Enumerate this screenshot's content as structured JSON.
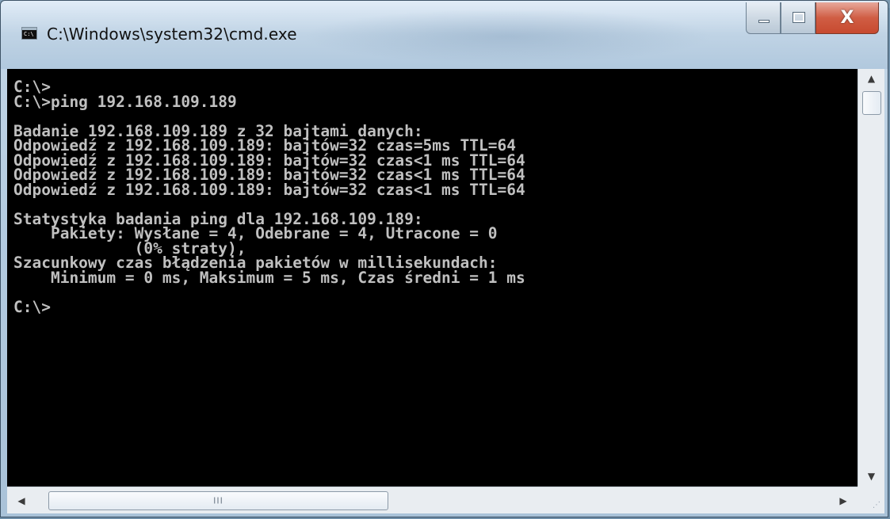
{
  "window": {
    "title": "C:\\Windows\\system32\\cmd.exe",
    "icon_label": "C:\\",
    "controls": {
      "close_glyph": "X"
    }
  },
  "console": {
    "text": "C:\\>\nC:\\>ping 192.168.109.189\n\nBadanie 192.168.109.189 z 32 bajtami danych:\nOdpowiedź z 192.168.109.189: bajtów=32 czas=5ms TTL=64\nOdpowiedź z 192.168.109.189: bajtów=32 czas<1 ms TTL=64\nOdpowiedź z 192.168.109.189: bajtów=32 czas<1 ms TTL=64\nOdpowiedź z 192.168.109.189: bajtów=32 czas<1 ms TTL=64\n\nStatystyka badania ping dla 192.168.109.189:\n    Pakiety: Wysłane = 4, Odebrane = 4, Utracone = 0\n             (0% straty),\nSzacunkowy czas błądzenia pakietów w millisekundach:\n    Minimum = 0 ms, Maksimum = 5 ms, Czas średni = 1 ms\n\nC:\\>",
    "colors": {
      "background": "#000000",
      "foreground": "#c0c0c0"
    }
  },
  "scrollbars": {
    "vertical_up": "▲",
    "vertical_down": "▼",
    "horizontal_left": "◀",
    "horizontal_right": "▶",
    "thumb_grip": "III"
  },
  "icons": {
    "app": "console-icon",
    "minimize": "minimize-icon",
    "maximize": "maximize-icon",
    "close": "close-icon",
    "resize": "size-grip-icon"
  }
}
